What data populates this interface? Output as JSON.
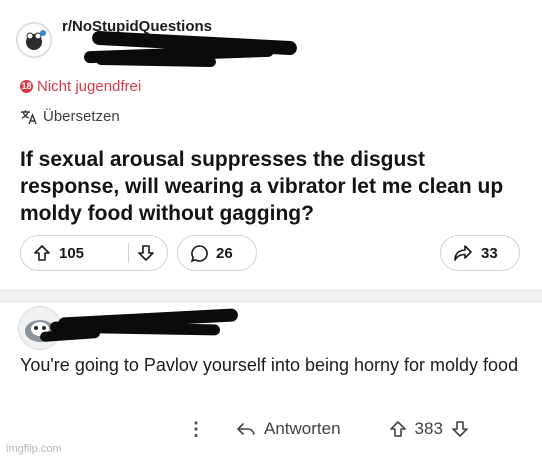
{
  "post": {
    "subreddit": "r/NoStupidQuestions",
    "nsfw_label": "Nicht jugendfrei",
    "translate_label": "Übersetzen",
    "title": "If sexual arousal suppresses the disgust response, will wearing a vibrator let me clean up moldy food without gagging?",
    "upvotes": "105",
    "comments": "26",
    "shares": "33"
  },
  "comment": {
    "text": "You're going to Pavlov yourself into being horny for moldy food",
    "reply_label": "Antworten",
    "votes": "383",
    "more_label": "⋮"
  },
  "watermark": "imgflip.com",
  "icons": {
    "subreddit_avatar": "subreddit-avatar-icon",
    "nsfw": "nsfw-icon",
    "translate": "translate-icon",
    "upvote": "upvote-icon",
    "downvote": "downvote-icon",
    "comment": "comment-icon",
    "share": "share-icon",
    "reply": "reply-icon",
    "more": "more-icon"
  },
  "colors": {
    "nsfw": "#d93a48",
    "redaction": "#0b0b0b",
    "pill_border": "#cfd3d7"
  }
}
